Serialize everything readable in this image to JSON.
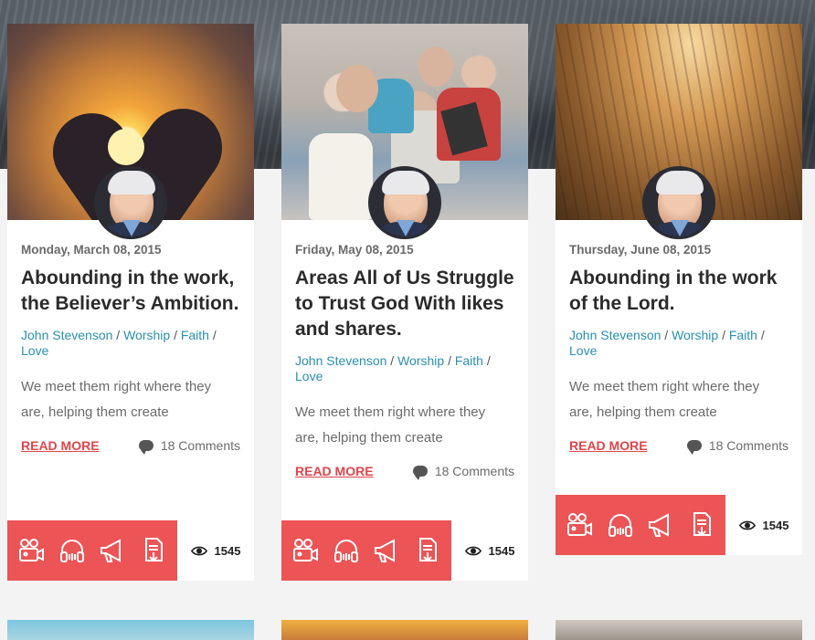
{
  "cards": [
    {
      "date": "Monday, March 08, 2015",
      "title": "Abounding in the work, the Believer’s Ambition.",
      "author": "John Stevenson",
      "tags": [
        "Worship",
        "Faith",
        "Love"
      ],
      "excerpt": "We meet them right where they are, helping them create",
      "read_more": "READ MORE",
      "comments": "18 Comments",
      "views": "1545"
    },
    {
      "date": "Friday, May 08, 2015",
      "title": "Areas All of Us Struggle to Trust God With likes and shares.",
      "author": "John Stevenson",
      "tags": [
        "Worship",
        "Faith",
        "Love"
      ],
      "excerpt": "We meet them right where they are, helping them create",
      "read_more": "READ MORE",
      "comments": "18 Comments",
      "views": "1545"
    },
    {
      "date": "Thursday, June 08, 2015",
      "title": "Abounding in the work of the Lord.",
      "author": "John Stevenson",
      "tags": [
        "Worship",
        "Faith",
        "Love"
      ],
      "excerpt": "We meet them right where they are, helping them create",
      "read_more": "READ MORE",
      "comments": "18 Comments",
      "views": "1545"
    }
  ],
  "separator": "/",
  "icons": [
    "video-camera-icon",
    "headphones-icon",
    "megaphone-icon",
    "document-icon",
    "eye-icon",
    "comment-icon"
  ],
  "colors": {
    "accent": "#ec5456",
    "link": "#2a8fb0",
    "read_more": "#e0454a"
  }
}
